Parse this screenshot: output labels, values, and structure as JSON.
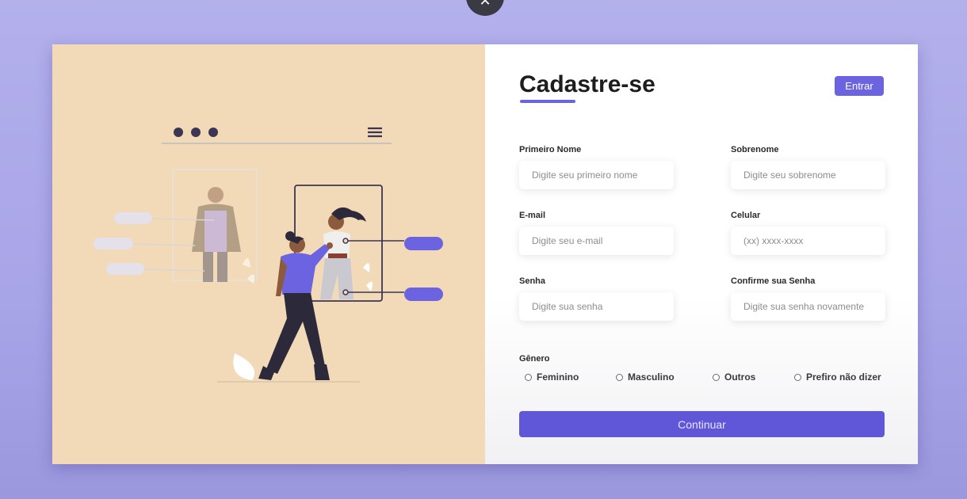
{
  "header": {
    "title": "Cadastre-se",
    "login_label": "Entrar"
  },
  "form": {
    "first_name": {
      "label": "Primeiro Nome",
      "placeholder": "Digite seu primeiro nome"
    },
    "last_name": {
      "label": "Sobrenome",
      "placeholder": "Digite seu sobrenome"
    },
    "email": {
      "label": "E-mail",
      "placeholder": "Digite seu e-mail"
    },
    "phone": {
      "label": "Celular",
      "placeholder": "(xx) xxxx-xxxx"
    },
    "password": {
      "label": "Senha",
      "placeholder": "Digite sua senha"
    },
    "confirm_password": {
      "label": "Confirme sua Senha",
      "placeholder": "Digite sua senha novamente"
    },
    "gender": {
      "label": "Gênero",
      "options": [
        "Feminino",
        "Masculino",
        "Outros",
        "Prefiro não dizer"
      ]
    },
    "submit_label": "Continuar"
  },
  "colors": {
    "accent": "#6c63e0",
    "illustration_background": "#f2dab8",
    "page_background": "#b3b0ec"
  },
  "icons": [
    "close-icon",
    "menu-icon",
    "radio-icon"
  ]
}
